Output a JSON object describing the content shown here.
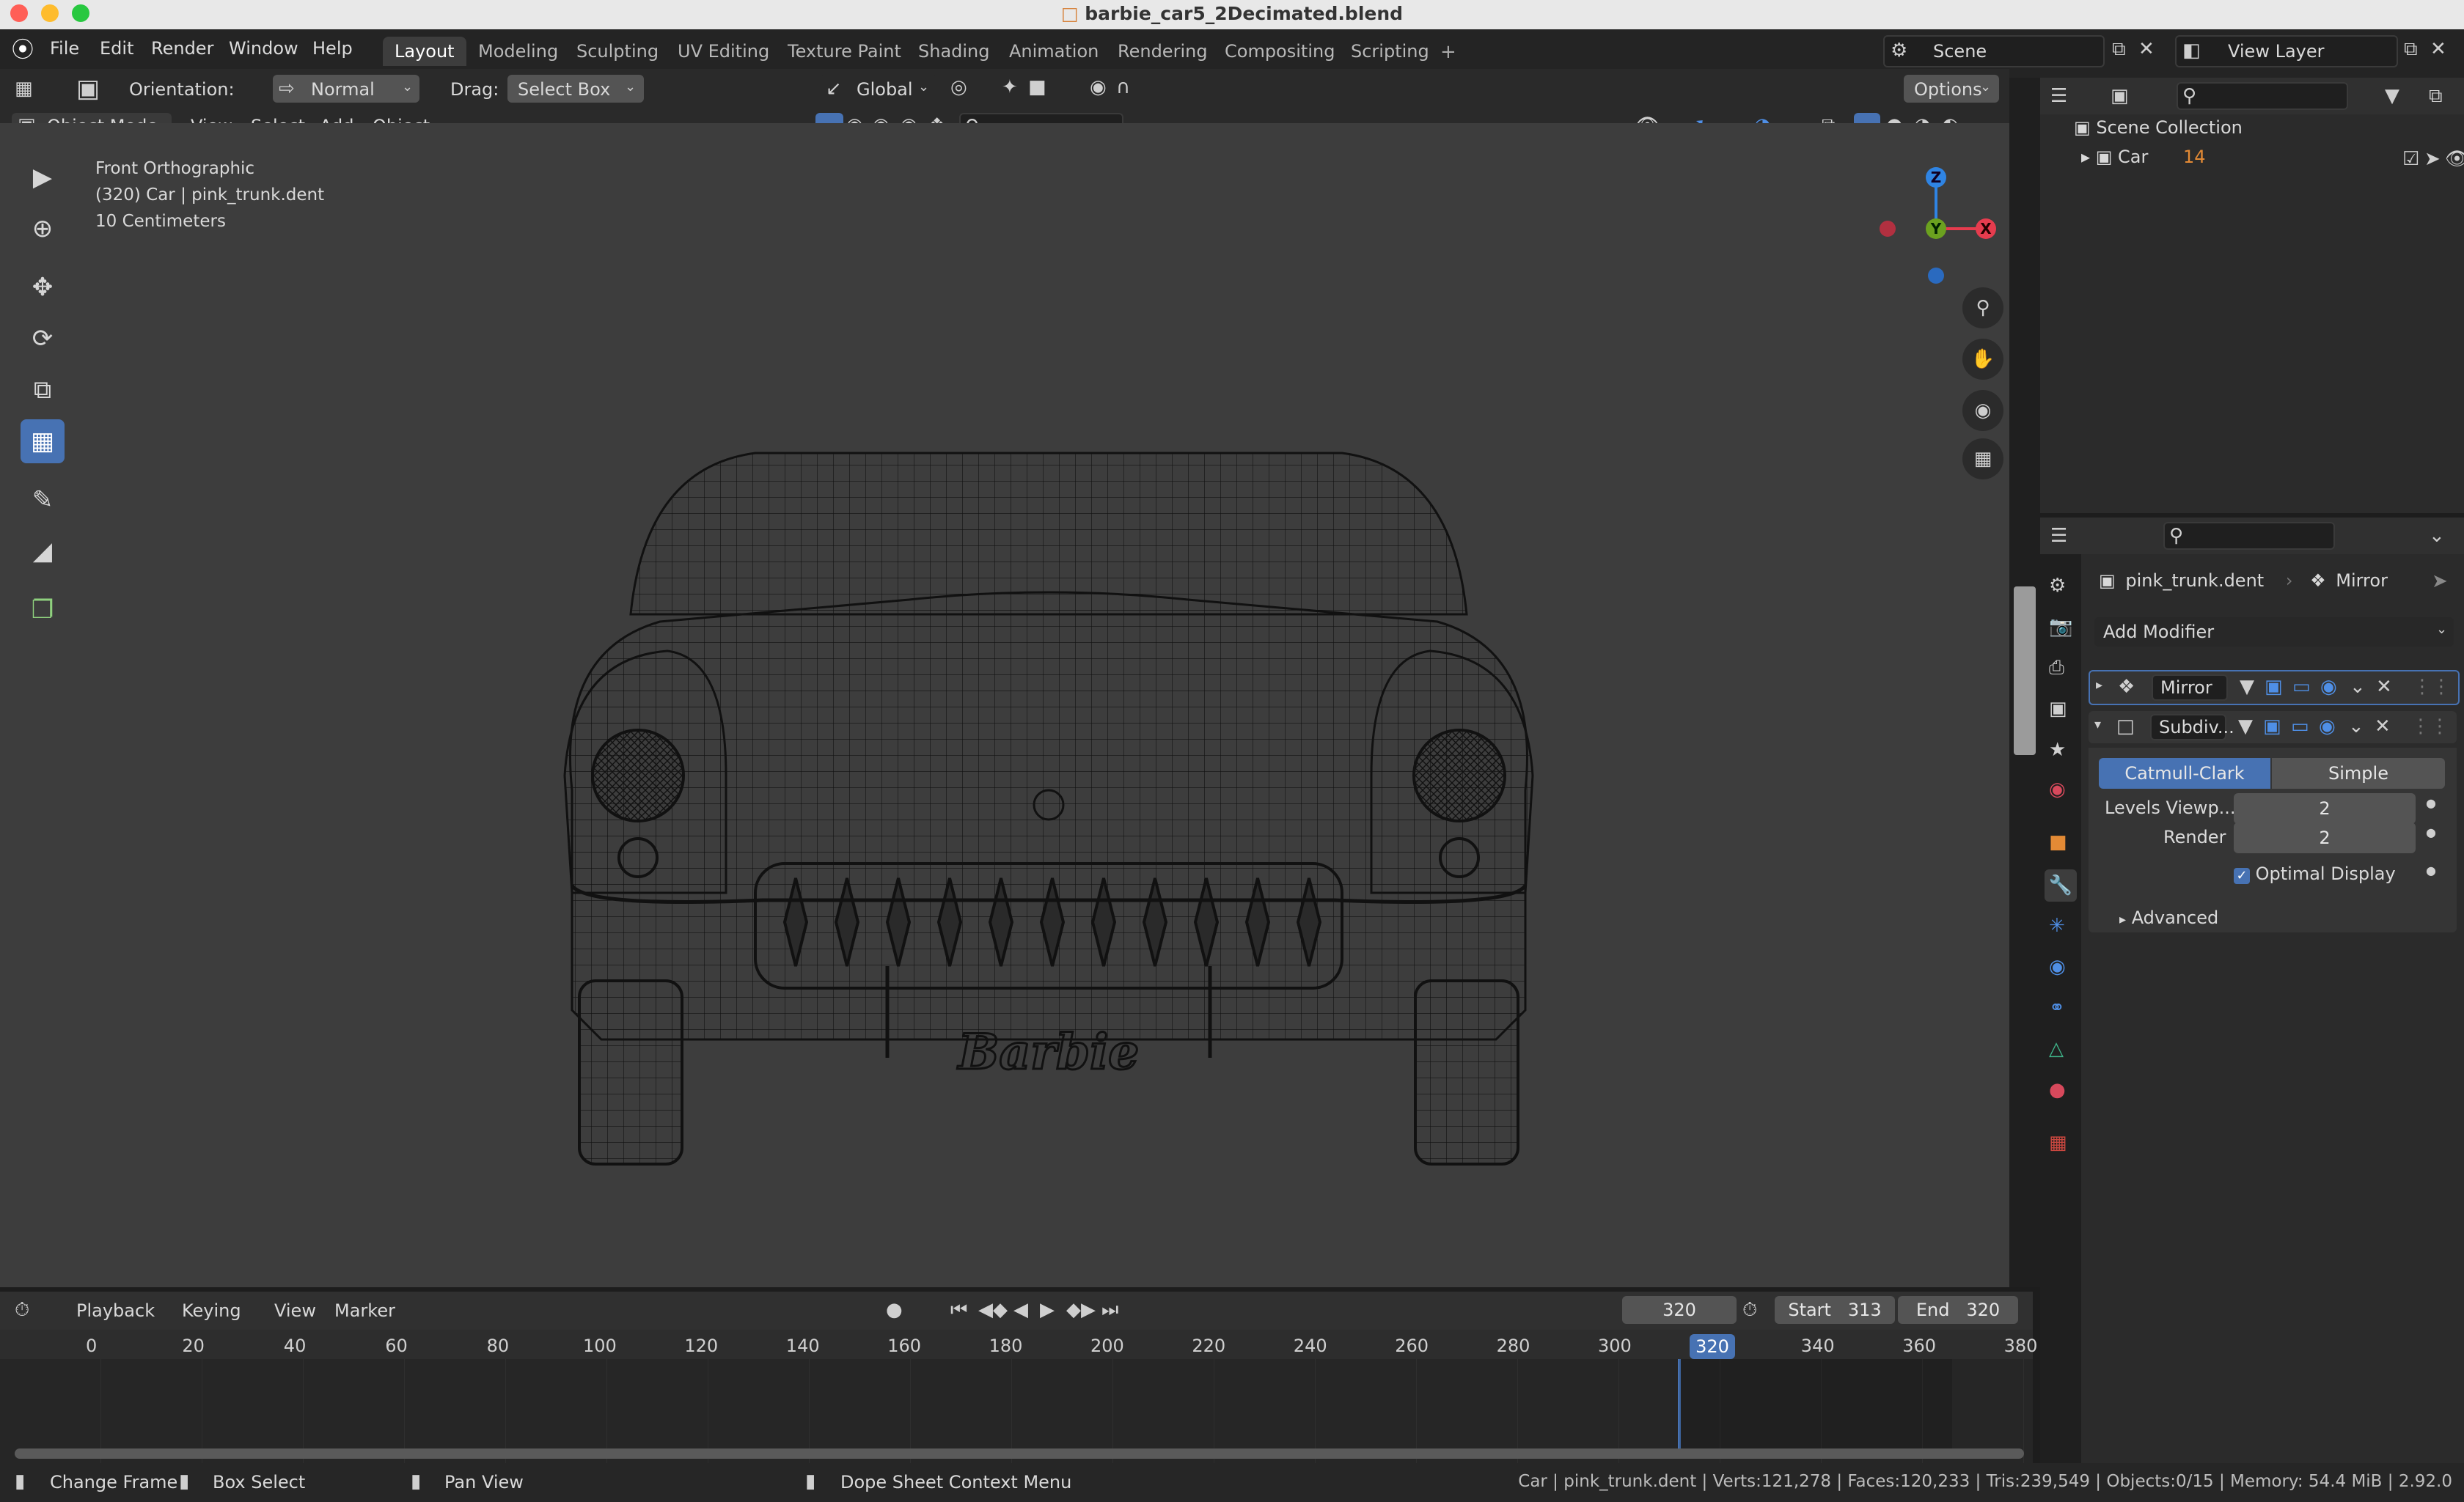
{
  "window": {
    "title": "barbie_car5_2Decimated.blend",
    "traffic_lights": [
      "#ff5f57",
      "#febc2e",
      "#28c840"
    ]
  },
  "menubar": {
    "menus": [
      "File",
      "Edit",
      "Render",
      "Window",
      "Help"
    ],
    "workspaces": [
      "Layout",
      "Modeling",
      "Sculpting",
      "UV Editing",
      "Texture Paint",
      "Shading",
      "Animation",
      "Rendering",
      "Compositing",
      "Scripting"
    ],
    "active_workspace": "Layout",
    "scene": "Scene",
    "view_layer": "View Layer"
  },
  "tool_header": {
    "orientation_label": "Orientation:",
    "orientation_value": "Normal",
    "drag_label": "Drag:",
    "drag_value": "Select Box",
    "transform_orientation": "Global",
    "options": "Options"
  },
  "viewport_header": {
    "mode": "Object Mode",
    "menus": [
      "View",
      "Select",
      "Add",
      "Object"
    ]
  },
  "viewport": {
    "info_line1": "Front Orthographic",
    "info_line2": "(320) Car | pink_trunk.dent",
    "info_line3": "10 Centimeters",
    "gizmo": {
      "z": "Z",
      "y": "Y",
      "x": "X",
      "x_color": "#e63c4e",
      "y_color": "#6ba11f",
      "z_color": "#2f84e3"
    },
    "plate_text": "Barbie"
  },
  "outliner": {
    "scene_collection": "Scene Collection",
    "item": "Car",
    "item_badge": "14"
  },
  "properties": {
    "object_name": "pink_trunk.dent",
    "modifier_context": "Mirror",
    "add_modifier": "Add Modifier",
    "modifiers": [
      {
        "name": "Mirror",
        "expanded": false
      },
      {
        "name": "Subdiv...",
        "expanded": true
      }
    ],
    "subdiv_tabs": [
      "Catmull-Clark",
      "Simple"
    ],
    "active_subdiv_tab": "Catmull-Clark",
    "levels_viewport_label": "Levels Viewp...",
    "levels_viewport": "2",
    "render_label": "Render",
    "render_levels": "2",
    "optimal_display": "Optimal Display",
    "advanced": "Advanced"
  },
  "timeline": {
    "menus": [
      "Playback",
      "Keying",
      "View",
      "Marker"
    ],
    "current_frame": "320",
    "start_label": "Start",
    "start": "313",
    "end_label": "End",
    "end": "320",
    "ticks": [
      "0",
      "20",
      "40",
      "60",
      "80",
      "100",
      "120",
      "140",
      "160",
      "180",
      "200",
      "220",
      "240",
      "260",
      "280",
      "300",
      "320",
      "340",
      "360",
      "380"
    ]
  },
  "statusbar": {
    "hints": [
      "Change Frame",
      "Box Select",
      "Pan View",
      "Dope Sheet Context Menu"
    ],
    "stats": "Car | pink_trunk.dent | Verts:121,278 | Faces:120,233 | Tris:239,549 | Objects:0/15 | Memory: 54.4 MiB | 2.92.0"
  }
}
